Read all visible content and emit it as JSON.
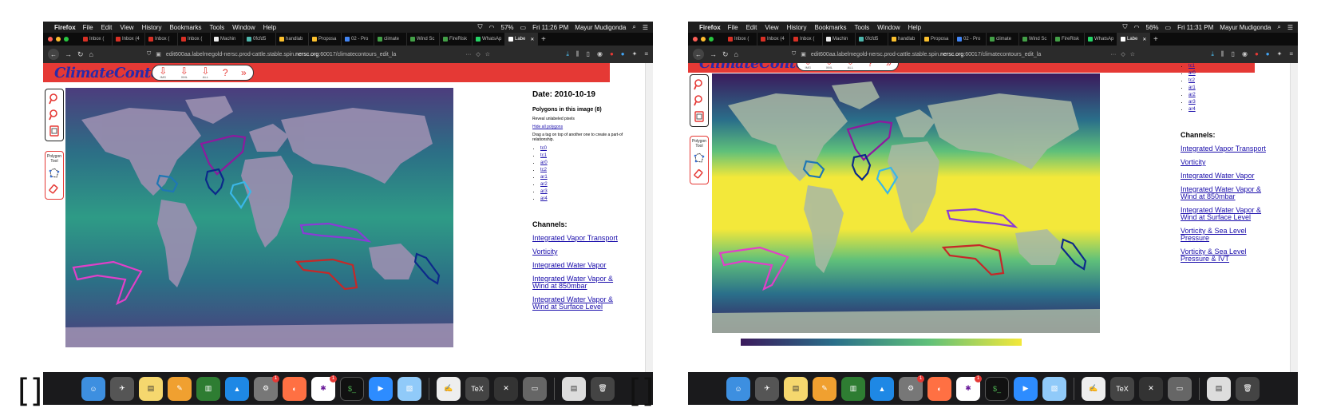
{
  "menubar": {
    "app": "Firefox",
    "menus": [
      "File",
      "Edit",
      "View",
      "History",
      "Bookmarks",
      "Tools",
      "Window",
      "Help"
    ],
    "user": "Mayur Mudigonda"
  },
  "tabs": [
    "Inbox (",
    "Inbox (4",
    "Inbox (",
    "Inbox (",
    "Machin",
    "0fcfd5",
    "handlab",
    "Proposa",
    "02 - Pro",
    "climate",
    "Wind Sc",
    "FireRisk",
    "WhatsAp",
    "Labe"
  ],
  "url": {
    "prefix": "edit600aa.labelmegold-nersc.prod-cattle.stable.spin.",
    "domain": "nersc.org",
    "suffix": ":60017/climatecontours_edit_la"
  },
  "left": {
    "time": "Fri 11:26 PM",
    "battery": "57%"
  },
  "right": {
    "time": "Fri 11:31 PM",
    "battery": "56%"
  },
  "app": {
    "logo": "ClimateContours",
    "download_labels": [
      "IMG",
      "XML",
      "ALL"
    ],
    "help": "?",
    "next": "»",
    "polygon_tool_label": "Polygon Tool"
  },
  "sidebar": {
    "date": "Date: 2010-10-19",
    "polygons_title": "Polygons in this image (8)",
    "reveal": "Reveal unlabeled pixels",
    "hide_all": "Hide all polygons",
    "drag_hint": "Drag a tag on top of another one to create a part-of relationship.",
    "tags": [
      "tc0",
      "tc1",
      "ar0",
      "tc2",
      "ar1",
      "ar2",
      "ar3",
      "ar4"
    ],
    "channels_title": "Channels:",
    "channels": [
      "Integrated Vapor Transport",
      "Vorticity",
      "Integrated Water Vapor",
      "Integrated Water Vapor & Wind at 850mbar",
      "Integrated Water Vapor & Wind at Surface Level",
      "Vorticity & Sea Level Pressure",
      "Vorticity & Sea Level Pressure & IVT"
    ]
  },
  "colors": {
    "header_red": "#e53935",
    "logo_blue": "#2a2aa8",
    "link_blue": "#1a0dab",
    "polygon_tc0": "#1f77b4",
    "polygon_tc1": "#0b2a8a",
    "polygon_tc2": "#3ab7e8",
    "polygon_ar0": "#8e1a9e",
    "polygon_ar1": "#8a3bd6",
    "polygon_ar2": "#c62828",
    "polygon_ar3": "#e040c8",
    "polygon_ar4": "#0d2a8a"
  },
  "dock_apps": [
    "finder-icon",
    "launchpad-icon",
    "notes-icon",
    "pages-icon",
    "numbers-icon",
    "keynote-icon",
    "system-preferences-icon",
    "firefox-icon",
    "slack-icon",
    "terminal-icon",
    "zoom-icon",
    "preview-icon",
    "textedit-icon",
    "texmaker-icon",
    "xquartz-icon",
    "archive-icon",
    "document-icon",
    "trash-icon"
  ],
  "dock_badges": {
    "system_prefs": "1",
    "slack": "1"
  },
  "bracket_label": "[]"
}
